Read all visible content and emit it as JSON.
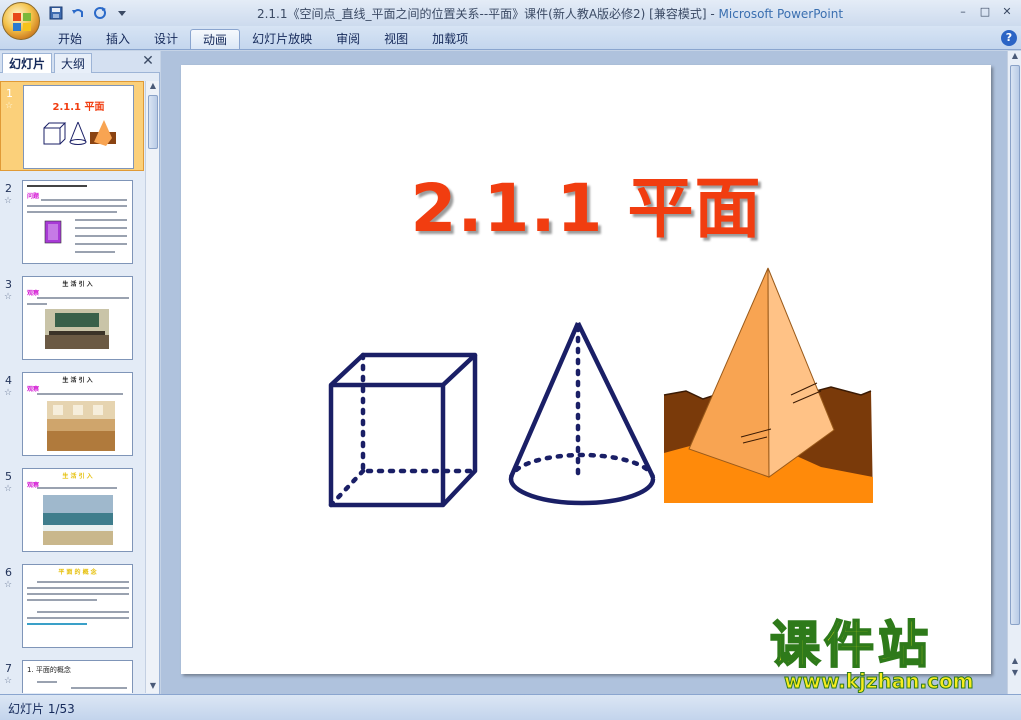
{
  "window": {
    "title": "2.1.1《空间点_直线_平面之间的位置关系--平面》课件(新人教A版必修2) [兼容模式]",
    "app_name": "Microsoft PowerPoint",
    "controls": [
      "–",
      "□",
      "✕"
    ]
  },
  "quick_access": {
    "icons": [
      "save-icon",
      "undo-icon",
      "redo-icon",
      "customize-icon"
    ]
  },
  "ribbon": {
    "tabs": [
      "开始",
      "插入",
      "设计",
      "动画",
      "幻灯片放映",
      "审阅",
      "视图",
      "加载项"
    ],
    "active_tab": "动画",
    "help": "?"
  },
  "left_panel": {
    "tabs": [
      "幻灯片",
      "大纲"
    ],
    "active_tab": "幻灯片",
    "close": "✕",
    "slides": [
      {
        "number": "1",
        "title": "2.1.1 平面",
        "selected": true
      },
      {
        "number": "2",
        "title": "",
        "heading": "问题"
      },
      {
        "number": "3",
        "title": "生 活 引 入",
        "heading": "观察"
      },
      {
        "number": "4",
        "title": "生 活 引 入",
        "heading": "观察"
      },
      {
        "number": "5",
        "title": "生 活 引 入",
        "heading": "观察"
      },
      {
        "number": "6",
        "title": "平 面 的 概 念"
      },
      {
        "number": "7",
        "title": "1. 平面的概念"
      }
    ]
  },
  "slide": {
    "title": "2.1.1 平面",
    "title_color": "#f13d10"
  },
  "watermark": {
    "text": "课件站",
    "url": "www.kjzhan.com"
  },
  "status": {
    "slide_counter": "幻灯片 1/53"
  },
  "colors": {
    "accent_selected": "#fbd07a",
    "shape_navy": "#1a1f66",
    "pyramid_orange": "#f8a452",
    "ground_brown": "#7a3a0a"
  }
}
